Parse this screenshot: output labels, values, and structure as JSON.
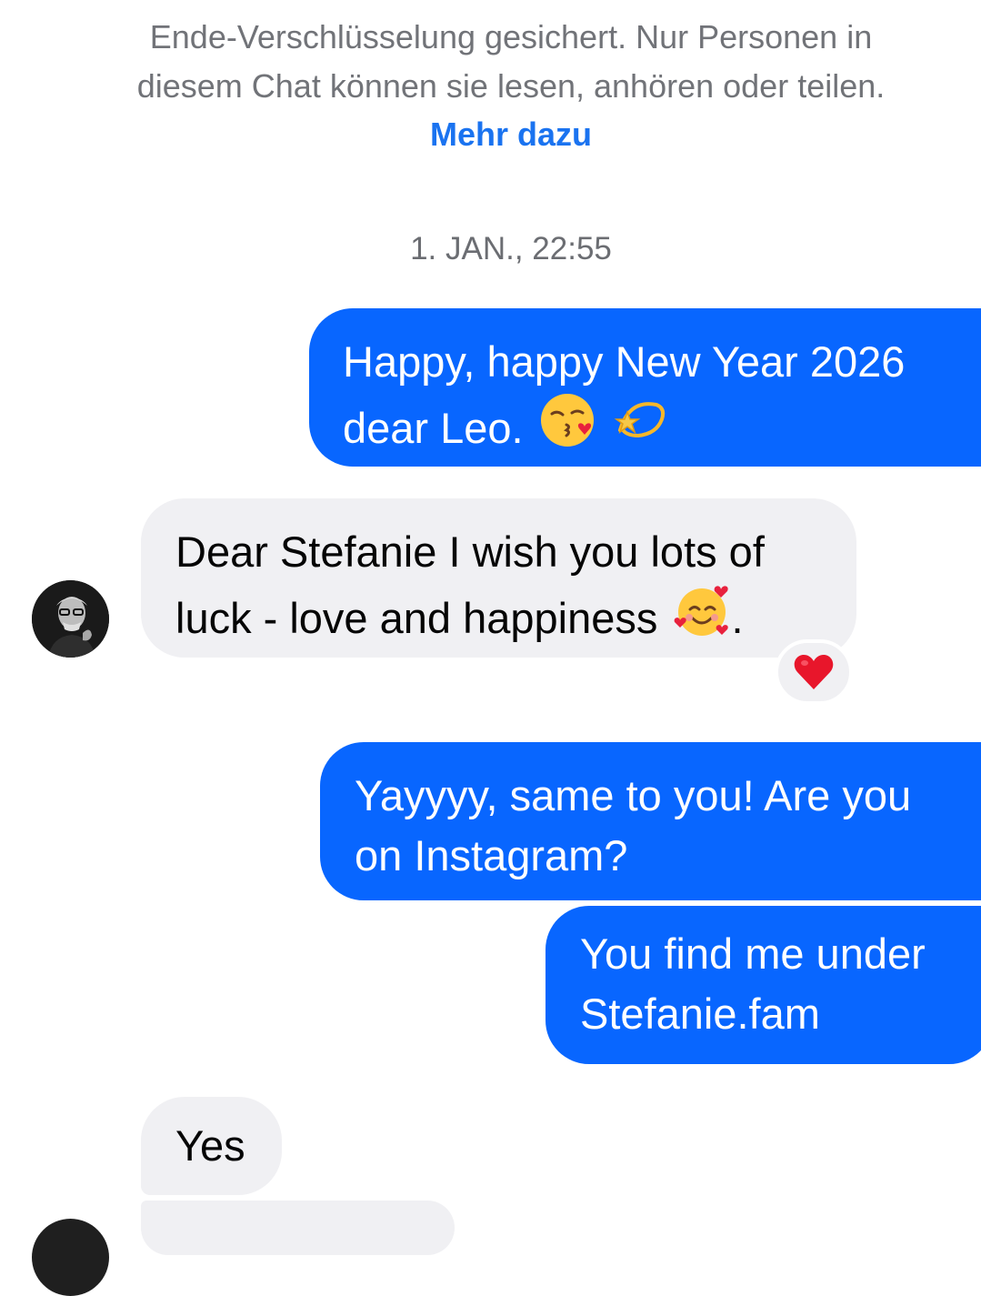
{
  "encryption_notice": {
    "line1": "Ende-Verschlüsselung gesichert. Nur Personen in",
    "line2": "diesem Chat können sie lesen, anhören oder teilen.",
    "link": "Mehr dazu"
  },
  "timestamp": "1. JAN., 22:55",
  "messages": [
    {
      "direction": "outgoing",
      "lines": [
        "Happy, happy New Year 2026",
        "dear Leo."
      ],
      "emojis": [
        "face-blowing-kiss-icon",
        "dizzy-star-icon"
      ]
    },
    {
      "direction": "incoming",
      "lines": [
        "Dear Stefanie I wish you lots of",
        "luck - love and happiness"
      ],
      "emojis": [
        "smiling-face-with-hearts-icon"
      ],
      "trailing_text": ".",
      "reaction": "red-heart-icon"
    },
    {
      "direction": "outgoing",
      "lines": [
        "Yayyyy, same to you! Are you",
        "on Instagram?"
      ]
    },
    {
      "direction": "outgoing",
      "lines": [
        "You find me under",
        "Stefanie.fam"
      ]
    },
    {
      "direction": "incoming",
      "lines": [
        "Yes"
      ]
    }
  ],
  "colors": {
    "outgoing_bubble": "#0866ff",
    "incoming_bubble": "#f0f0f3",
    "link": "#1a73f0",
    "muted_text": "#717378"
  }
}
